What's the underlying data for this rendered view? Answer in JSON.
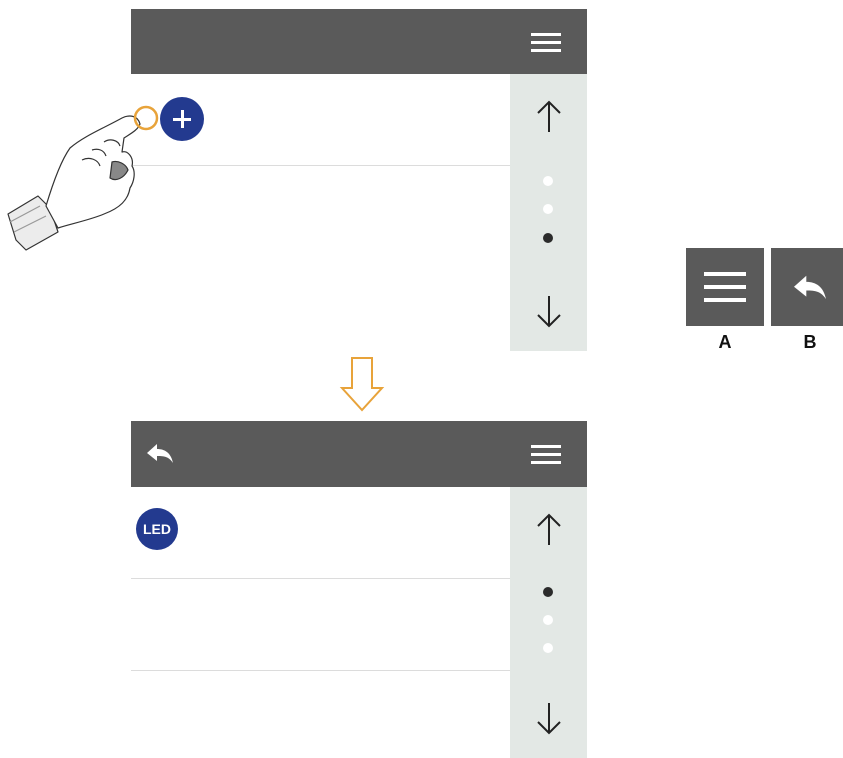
{
  "screen_before": {
    "add_button_label": "+",
    "page_dots": [
      "inactive",
      "inactive",
      "active"
    ],
    "icons": {
      "menu": "menu-icon",
      "up": "arrow-up-icon",
      "down": "arrow-down-icon"
    }
  },
  "screen_after": {
    "led_button_label": "LED",
    "page_dots": [
      "active",
      "inactive",
      "inactive"
    ],
    "icons": {
      "back": "back-icon",
      "menu": "menu-icon",
      "up": "arrow-up-icon",
      "down": "arrow-down-icon"
    }
  },
  "legend": {
    "a_label": "A",
    "b_label": "B"
  },
  "colors": {
    "header": "#5a5a5a",
    "scrollbar": "#e3e8e5",
    "round_button": "#233a8f",
    "transition_arrow": "#e8a33a",
    "touch_ring": "#e8a33a"
  }
}
